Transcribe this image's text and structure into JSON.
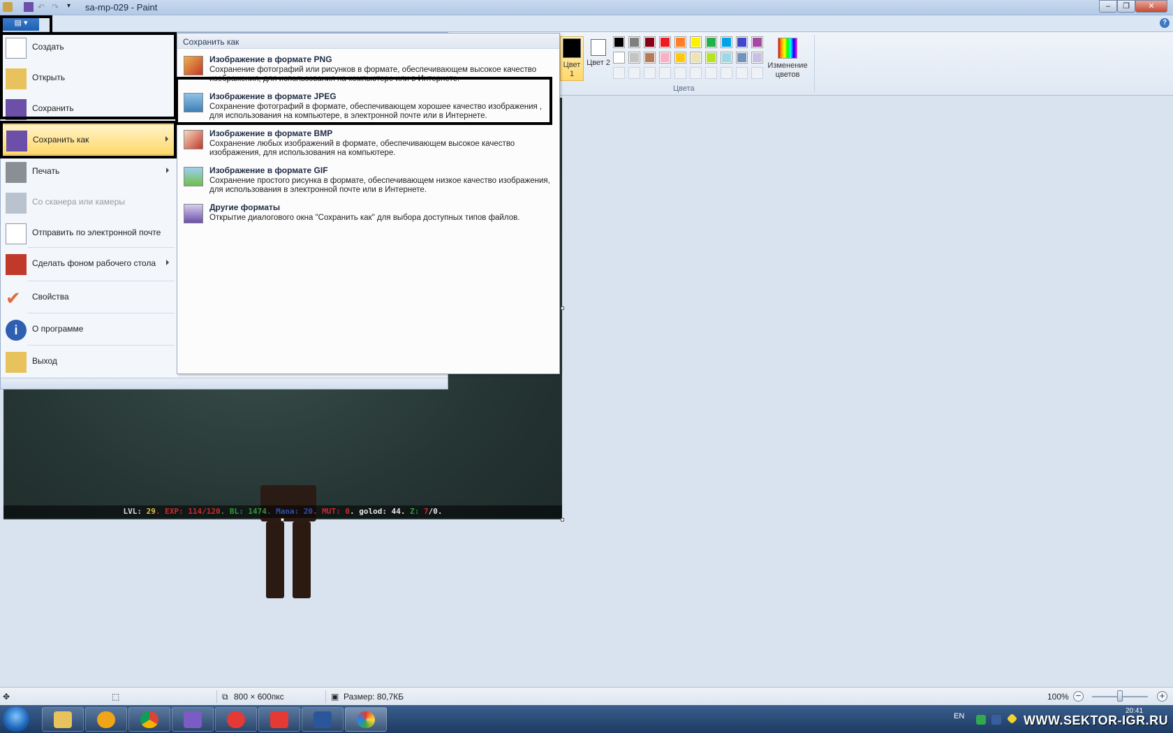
{
  "window": {
    "title": "sa-mp-029 - Paint"
  },
  "ribbon": {
    "color1_label": "Цвет 1",
    "color2_label": "Цвет 2",
    "edit_colors_label": "Изменение цветов",
    "colors_group_label": "Цвета",
    "color1": "#000000",
    "color2": "#ffffff",
    "palette_row1": [
      "#000000",
      "#7f7f7f",
      "#880015",
      "#ed1c24",
      "#ff7f27",
      "#fff200",
      "#22b14c",
      "#00a2e8",
      "#3f48cc",
      "#a349a4"
    ],
    "palette_row2": [
      "#ffffff",
      "#c3c3c3",
      "#b97a57",
      "#ffaec9",
      "#ffc90e",
      "#efe4b0",
      "#b5e61d",
      "#99d9ea",
      "#7092be",
      "#c8bfe7"
    ]
  },
  "app_menu": {
    "items": [
      {
        "label": "Создать",
        "icon": "new-file-icon"
      },
      {
        "label": "Открыть",
        "icon": "open-folder-icon"
      },
      {
        "label": "Сохранить",
        "icon": "save-icon"
      },
      {
        "label": "Сохранить как",
        "icon": "save-as-icon"
      },
      {
        "label": "Печать",
        "icon": "printer-icon"
      },
      {
        "label": "Со сканера или камеры",
        "icon": "scanner-icon"
      },
      {
        "label": "Отправить по электронной почте",
        "icon": "email-icon"
      },
      {
        "label": "Сделать фоном рабочего стола",
        "icon": "desktop-background-icon"
      },
      {
        "label": "Свойства",
        "icon": "checkmark-icon"
      },
      {
        "label": "О программе",
        "icon": "info-icon"
      },
      {
        "label": "Выход",
        "icon": "exit-icon"
      }
    ]
  },
  "save_as_menu": {
    "header": "Сохранить как",
    "items": [
      {
        "title": "Изображение в формате PNG",
        "desc": "Сохранение фотографий или рисунков в формате, обеспечивающем высокое качество изображения, для использования на компьютере или в Интернете."
      },
      {
        "title": "Изображение в формате JPEG",
        "desc": "Сохранение фотографий в формате, обеспечивающем хорошее качество изображения , для использования на компьютере, в электронной почте или в Интернете."
      },
      {
        "title": "Изображение в формате BMP",
        "desc": "Сохранение любых изображений в формате, обеспечивающем высокое качество изображения, для использования на компьютере."
      },
      {
        "title": "Изображение в формате GIF",
        "desc": "Сохранение простого рисунка в формате, обеспечивающем низкое качество изображения, для использования в электронной почте или в Интернете."
      },
      {
        "title": "Другие форматы",
        "desc": "Открытие диалогового окна \"Сохранить как\" для выбора доступных типов файлов."
      }
    ]
  },
  "hud": {
    "parts": [
      {
        "text": "LVL: ",
        "color": "#d8d8d8"
      },
      {
        "text": "29",
        "color": "#e0c040"
      },
      {
        "text": ". EXP: ",
        "color": "#cc2a2a"
      },
      {
        "text": "114/120",
        "color": "#cc2a2a"
      },
      {
        "text": ". BL: ",
        "color": "#2f9a3a"
      },
      {
        "text": "1474",
        "color": "#2f9a3a"
      },
      {
        "text": ". Mana: ",
        "color": "#2e4fb0"
      },
      {
        "text": "20",
        "color": "#2e4fb0"
      },
      {
        "text": ". MUT: ",
        "color": "#cc2a2a"
      },
      {
        "text": "0",
        "color": "#cc2a2a"
      },
      {
        "text": ". golod: 44. ",
        "color": "#e8e8e8"
      },
      {
        "text": "Z: ",
        "color": "#2f9a3a"
      },
      {
        "text": "7",
        "color": "#cc2a2a"
      },
      {
        "text": "/0.",
        "color": "#e8e8e8"
      }
    ]
  },
  "status_bar": {
    "dimensions": "800 × 600пкс",
    "size": "Размер: 80,7КБ",
    "zoom": "100%",
    "zoom_level": 0.5
  },
  "taskbar": {
    "lang": "EN",
    "watermark": "WWW.SEKTOR-IGR.RU",
    "clock": "20:41"
  }
}
